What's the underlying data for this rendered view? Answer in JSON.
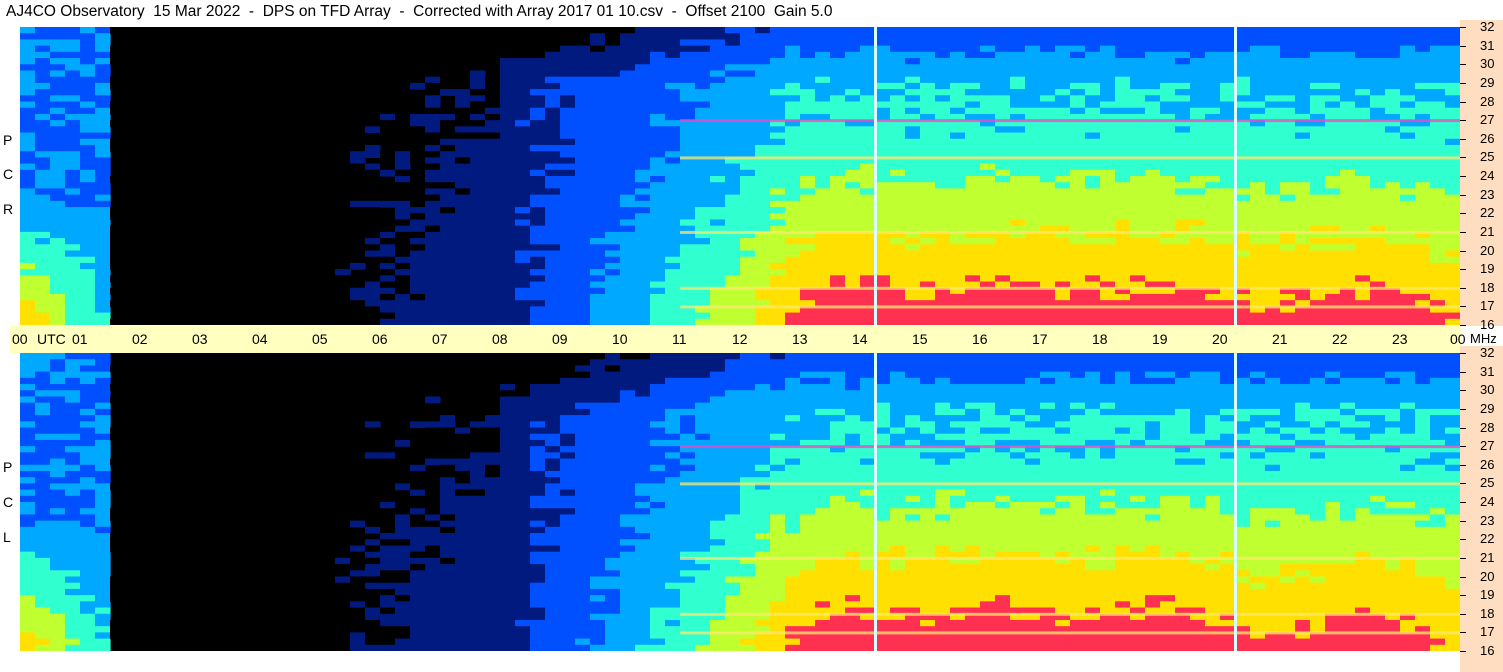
{
  "title": "AJ4CO Observatory  15 Mar 2022  -  DPS on TFD Array  -  Corrected with Array 2017 01 10.csv  -  Offset 2100  Gain 5.0",
  "panels": [
    {
      "label_letters": [
        "P",
        "C",
        "R"
      ]
    },
    {
      "label_letters": [
        "P",
        "C",
        "L"
      ]
    }
  ],
  "utc_axis": {
    "unit": "UTC",
    "labels": [
      "00",
      "01",
      "02",
      "03",
      "04",
      "05",
      "06",
      "07",
      "08",
      "09",
      "10",
      "11",
      "12",
      "13",
      "14",
      "15",
      "16",
      "17",
      "18",
      "19",
      "20",
      "21",
      "22",
      "23",
      "00"
    ]
  },
  "mhz_axis": {
    "unit": "MHz",
    "labels": [
      "32",
      "31",
      "30",
      "29",
      "28",
      "27",
      "26",
      "25",
      "24",
      "23",
      "22",
      "21",
      "20",
      "19",
      "18",
      "17",
      "16"
    ]
  },
  "chart_data": [
    {
      "type": "heatmap",
      "title": "AJ4CO Observatory  15 Mar 2022  -  DPS on TFD Array  -  Corrected with Array 2017 01 10.csv  -  Offset 2100  Gain 5.0",
      "panel": "RCP",
      "x_unit": "UTC",
      "xlim": [
        0,
        24
      ],
      "y_unit": "MHz",
      "ylim": [
        16,
        32
      ],
      "colorscale": [
        "#000000",
        "#001a80",
        "#0050ff",
        "#00a8ff",
        "#30ffd0",
        "#c0ff30",
        "#ffe000",
        "#ff3050",
        "#ff40ff",
        "#ffffff"
      ],
      "bright_bands_mhz": [
        17.0,
        18.0,
        21.0,
        25.0,
        27.0
      ],
      "vertical_lines_utc": [
        14.25,
        20.25
      ]
    },
    {
      "type": "heatmap",
      "panel": "LCP",
      "x_unit": "UTC",
      "xlim": [
        0,
        24
      ],
      "y_unit": "MHz",
      "ylim": [
        16,
        32
      ],
      "colorscale": [
        "#000000",
        "#001a80",
        "#0050ff",
        "#00a8ff",
        "#30ffd0",
        "#c0ff30",
        "#ffe000",
        "#ff3050",
        "#ff40ff",
        "#ffffff"
      ],
      "bright_bands_mhz": [
        17.0,
        18.0,
        21.0,
        25.0,
        27.0
      ],
      "vertical_lines_utc": [
        14.25,
        20.25
      ]
    }
  ]
}
